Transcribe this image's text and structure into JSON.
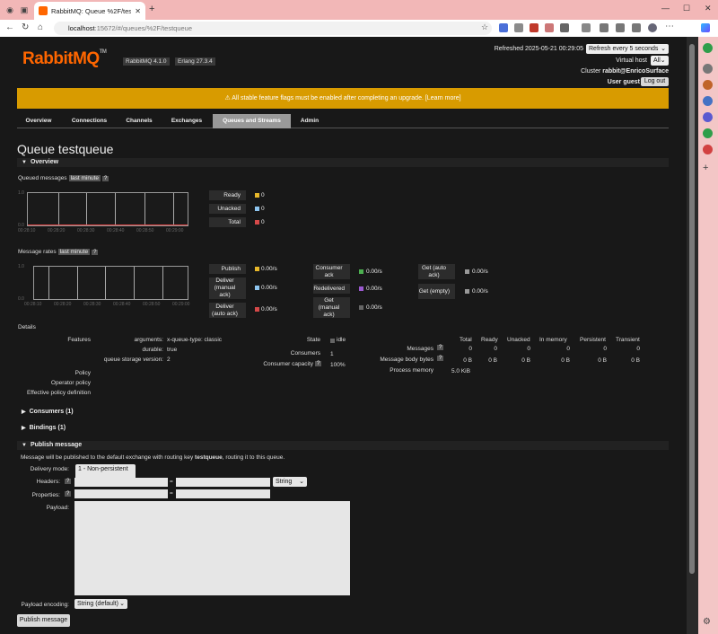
{
  "browser": {
    "tab_title": "RabbitMQ: Queue %2F/testqueue",
    "url_host": "localhost",
    "url_path": ":15672/#/queues/%2F/testqueue"
  },
  "header": {
    "logo_text": "RabbitMQ",
    "logo_tm": "TM",
    "rabbitmq_version": "RabbitMQ 4.1.0",
    "erlang_version": "Erlang 27.3.4",
    "refreshed": "Refreshed 2025-05-21 00:29:05",
    "refresh_option": "Refresh every 5 seconds",
    "vhost_label": "Virtual host",
    "vhost_value": "All",
    "cluster_label": "Cluster",
    "cluster_value": "rabbit@EnricoSurface",
    "user_label": "User",
    "user_value": "guest",
    "logout": "Log out"
  },
  "banner": "⚠ All stable feature flags must be enabled after completing an upgrade. [Learn more]",
  "tabs": [
    "Overview",
    "Connections",
    "Channels",
    "Exchanges",
    "Queues and Streams",
    "Admin"
  ],
  "title": "Queue testqueue",
  "overview": {
    "section": "Overview",
    "queued_label": "Queued messages",
    "queued_period": "last minute",
    "help": "?",
    "queued_ylabels": [
      "1.0",
      "0.0"
    ],
    "queued_x": [
      "00:28:10",
      "00:28:20",
      "00:28:30",
      "00:28:40",
      "00:28:50",
      "00:29:00"
    ],
    "queued_legend": [
      {
        "name": "Ready",
        "value": "0",
        "color": "#e8b82a"
      },
      {
        "name": "Unacked",
        "value": "0",
        "color": "#8ec5ef"
      },
      {
        "name": "Total",
        "value": "0",
        "color": "#d64949"
      }
    ],
    "rates_label": "Message rates",
    "rates_period": "last minute",
    "rates_ylabels": [
      "1.0",
      "0.0"
    ],
    "rates_x": [
      "00:28:10",
      "00:28:20",
      "00:28:30",
      "00:28:40",
      "00:28:50",
      "00:29:00"
    ],
    "rates_legend": [
      {
        "name": "Publish",
        "value": "0.00/s",
        "color": "#e8b82a"
      },
      {
        "name": "Deliver (manual ack)",
        "value": "0.00/s",
        "color": "#8ec5ef"
      },
      {
        "name": "Deliver (auto ack)",
        "value": "0.00/s",
        "color": "#d64949"
      },
      {
        "name": "Consumer ack",
        "value": "0.00/s",
        "color": "#4caf50"
      },
      {
        "name": "Redelivered",
        "value": "0.00/s",
        "color": "#9b59d0"
      },
      {
        "name": "Get (manual ack)",
        "value": "0.00/s",
        "color": "#666666"
      },
      {
        "name": "Get (auto ack)",
        "value": "0.00/s",
        "color": "#999999"
      },
      {
        "name": "Get (empty)",
        "value": "0.00/s",
        "color": "#999999"
      }
    ]
  },
  "details": {
    "label": "Details",
    "features": "Features",
    "arguments_k": "arguments:",
    "arguments_v": "x-queue-type: classic",
    "durable_k": "durable:",
    "durable_v": "true",
    "storage_k": "queue storage version:",
    "storage_v": "2",
    "policy": "Policy",
    "operator_policy": "Operator policy",
    "effective_policy": "Effective policy definition",
    "state_k": "State",
    "state_v": "idle",
    "consumers_k": "Consumers",
    "consumers_v": "1",
    "capacity_k": "Consumer capacity",
    "capacity_v": "100%",
    "cols": [
      "Total",
      "Ready",
      "Unacked",
      "In memory",
      "Persistent",
      "Transient"
    ],
    "messages_k": "Messages",
    "messages_v": [
      "0",
      "0",
      "0",
      "0",
      "0",
      "0"
    ],
    "bytes_k": "Message body bytes",
    "bytes_v": [
      "0 B",
      "0 B",
      "0 B",
      "0 B",
      "0 B",
      "0 B"
    ],
    "memory_k": "Process memory",
    "memory_v": "5.0 KiB"
  },
  "consumers_section": "Consumers (1)",
  "bindings_section": "Bindings (1)",
  "publish": {
    "section": "Publish message",
    "desc_pre": "Message will be published to the default exchange with routing key ",
    "desc_key": "testqueue",
    "desc_post": ", routing it to this queue.",
    "delivery_mode_label": "Delivery mode:",
    "delivery_mode_value": "1 - Non-persistent",
    "headers_label": "Headers:",
    "header_type": "String",
    "properties_label": "Properties:",
    "payload_label": "Payload:",
    "encoding_label": "Payload encoding:",
    "encoding_value": "String (default)",
    "button": "Publish message",
    "eq": "="
  }
}
